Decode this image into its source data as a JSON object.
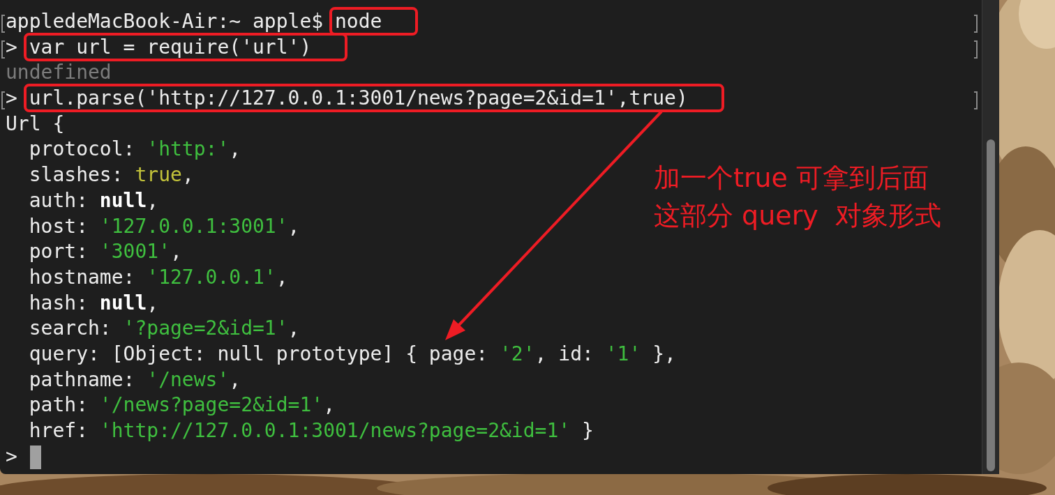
{
  "terminal": {
    "lines": [
      {
        "kind": "prompt",
        "marked": true,
        "prompt": "appledeMacBook-Air:~ apple$ ",
        "input": "node",
        "boxed": true
      },
      {
        "kind": "prompt",
        "marked": true,
        "prompt": "> ",
        "input": "var url = require('url')",
        "boxed": true
      },
      {
        "kind": "output",
        "marked": false,
        "segments": [
          {
            "kind": "dim",
            "text": "undefined"
          }
        ]
      },
      {
        "kind": "prompt",
        "marked": true,
        "prompt": "> ",
        "input": "url.parse('http://127.0.0.1:3001/news?page=2&id=1',true)",
        "boxed": true
      },
      {
        "kind": "output",
        "marked": false,
        "segments": [
          {
            "kind": "plain",
            "text": "Url {"
          }
        ]
      },
      {
        "kind": "output",
        "marked": false,
        "segments": [
          {
            "kind": "plain",
            "text": "  protocol: "
          },
          {
            "kind": "string",
            "text": "'http:'"
          },
          {
            "kind": "plain",
            "text": ","
          }
        ]
      },
      {
        "kind": "output",
        "marked": false,
        "segments": [
          {
            "kind": "plain",
            "text": "  slashes: "
          },
          {
            "kind": "bool",
            "text": "true"
          },
          {
            "kind": "plain",
            "text": ","
          }
        ]
      },
      {
        "kind": "output",
        "marked": false,
        "segments": [
          {
            "kind": "plain",
            "text": "  auth: "
          },
          {
            "kind": "null",
            "text": "null"
          },
          {
            "kind": "plain",
            "text": ","
          }
        ]
      },
      {
        "kind": "output",
        "marked": false,
        "segments": [
          {
            "kind": "plain",
            "text": "  host: "
          },
          {
            "kind": "string",
            "text": "'127.0.0.1:3001'"
          },
          {
            "kind": "plain",
            "text": ","
          }
        ]
      },
      {
        "kind": "output",
        "marked": false,
        "segments": [
          {
            "kind": "plain",
            "text": "  port: "
          },
          {
            "kind": "string",
            "text": "'3001'"
          },
          {
            "kind": "plain",
            "text": ","
          }
        ]
      },
      {
        "kind": "output",
        "marked": false,
        "segments": [
          {
            "kind": "plain",
            "text": "  hostname: "
          },
          {
            "kind": "string",
            "text": "'127.0.0.1'"
          },
          {
            "kind": "plain",
            "text": ","
          }
        ]
      },
      {
        "kind": "output",
        "marked": false,
        "segments": [
          {
            "kind": "plain",
            "text": "  hash: "
          },
          {
            "kind": "null",
            "text": "null"
          },
          {
            "kind": "plain",
            "text": ","
          }
        ]
      },
      {
        "kind": "output",
        "marked": false,
        "segments": [
          {
            "kind": "plain",
            "text": "  search: "
          },
          {
            "kind": "string",
            "text": "'?page=2&id=1'"
          },
          {
            "kind": "plain",
            "text": ","
          }
        ]
      },
      {
        "kind": "output",
        "marked": false,
        "segments": [
          {
            "kind": "plain",
            "text": "  query: [Object: null prototype] { page: "
          },
          {
            "kind": "string",
            "text": "'2'"
          },
          {
            "kind": "plain",
            "text": ", id: "
          },
          {
            "kind": "string",
            "text": "'1'"
          },
          {
            "kind": "plain",
            "text": " },"
          }
        ]
      },
      {
        "kind": "output",
        "marked": false,
        "segments": [
          {
            "kind": "plain",
            "text": "  pathname: "
          },
          {
            "kind": "string",
            "text": "'/news'"
          },
          {
            "kind": "plain",
            "text": ","
          }
        ]
      },
      {
        "kind": "output",
        "marked": false,
        "segments": [
          {
            "kind": "plain",
            "text": "  path: "
          },
          {
            "kind": "string",
            "text": "'/news?page=2&id=1'"
          },
          {
            "kind": "plain",
            "text": ","
          }
        ]
      },
      {
        "kind": "output",
        "marked": false,
        "segments": [
          {
            "kind": "plain",
            "text": "  href: "
          },
          {
            "kind": "string",
            "text": "'http://127.0.0.1:3001/news?page=2&id=1'"
          },
          {
            "kind": "plain",
            "text": " }"
          }
        ]
      },
      {
        "kind": "prompt",
        "marked": false,
        "prompt": ">",
        "cursor": true
      }
    ]
  },
  "annotation": {
    "lines": [
      "加一个true 可拿到后面",
      "这部分 query  对象形式"
    ]
  }
}
